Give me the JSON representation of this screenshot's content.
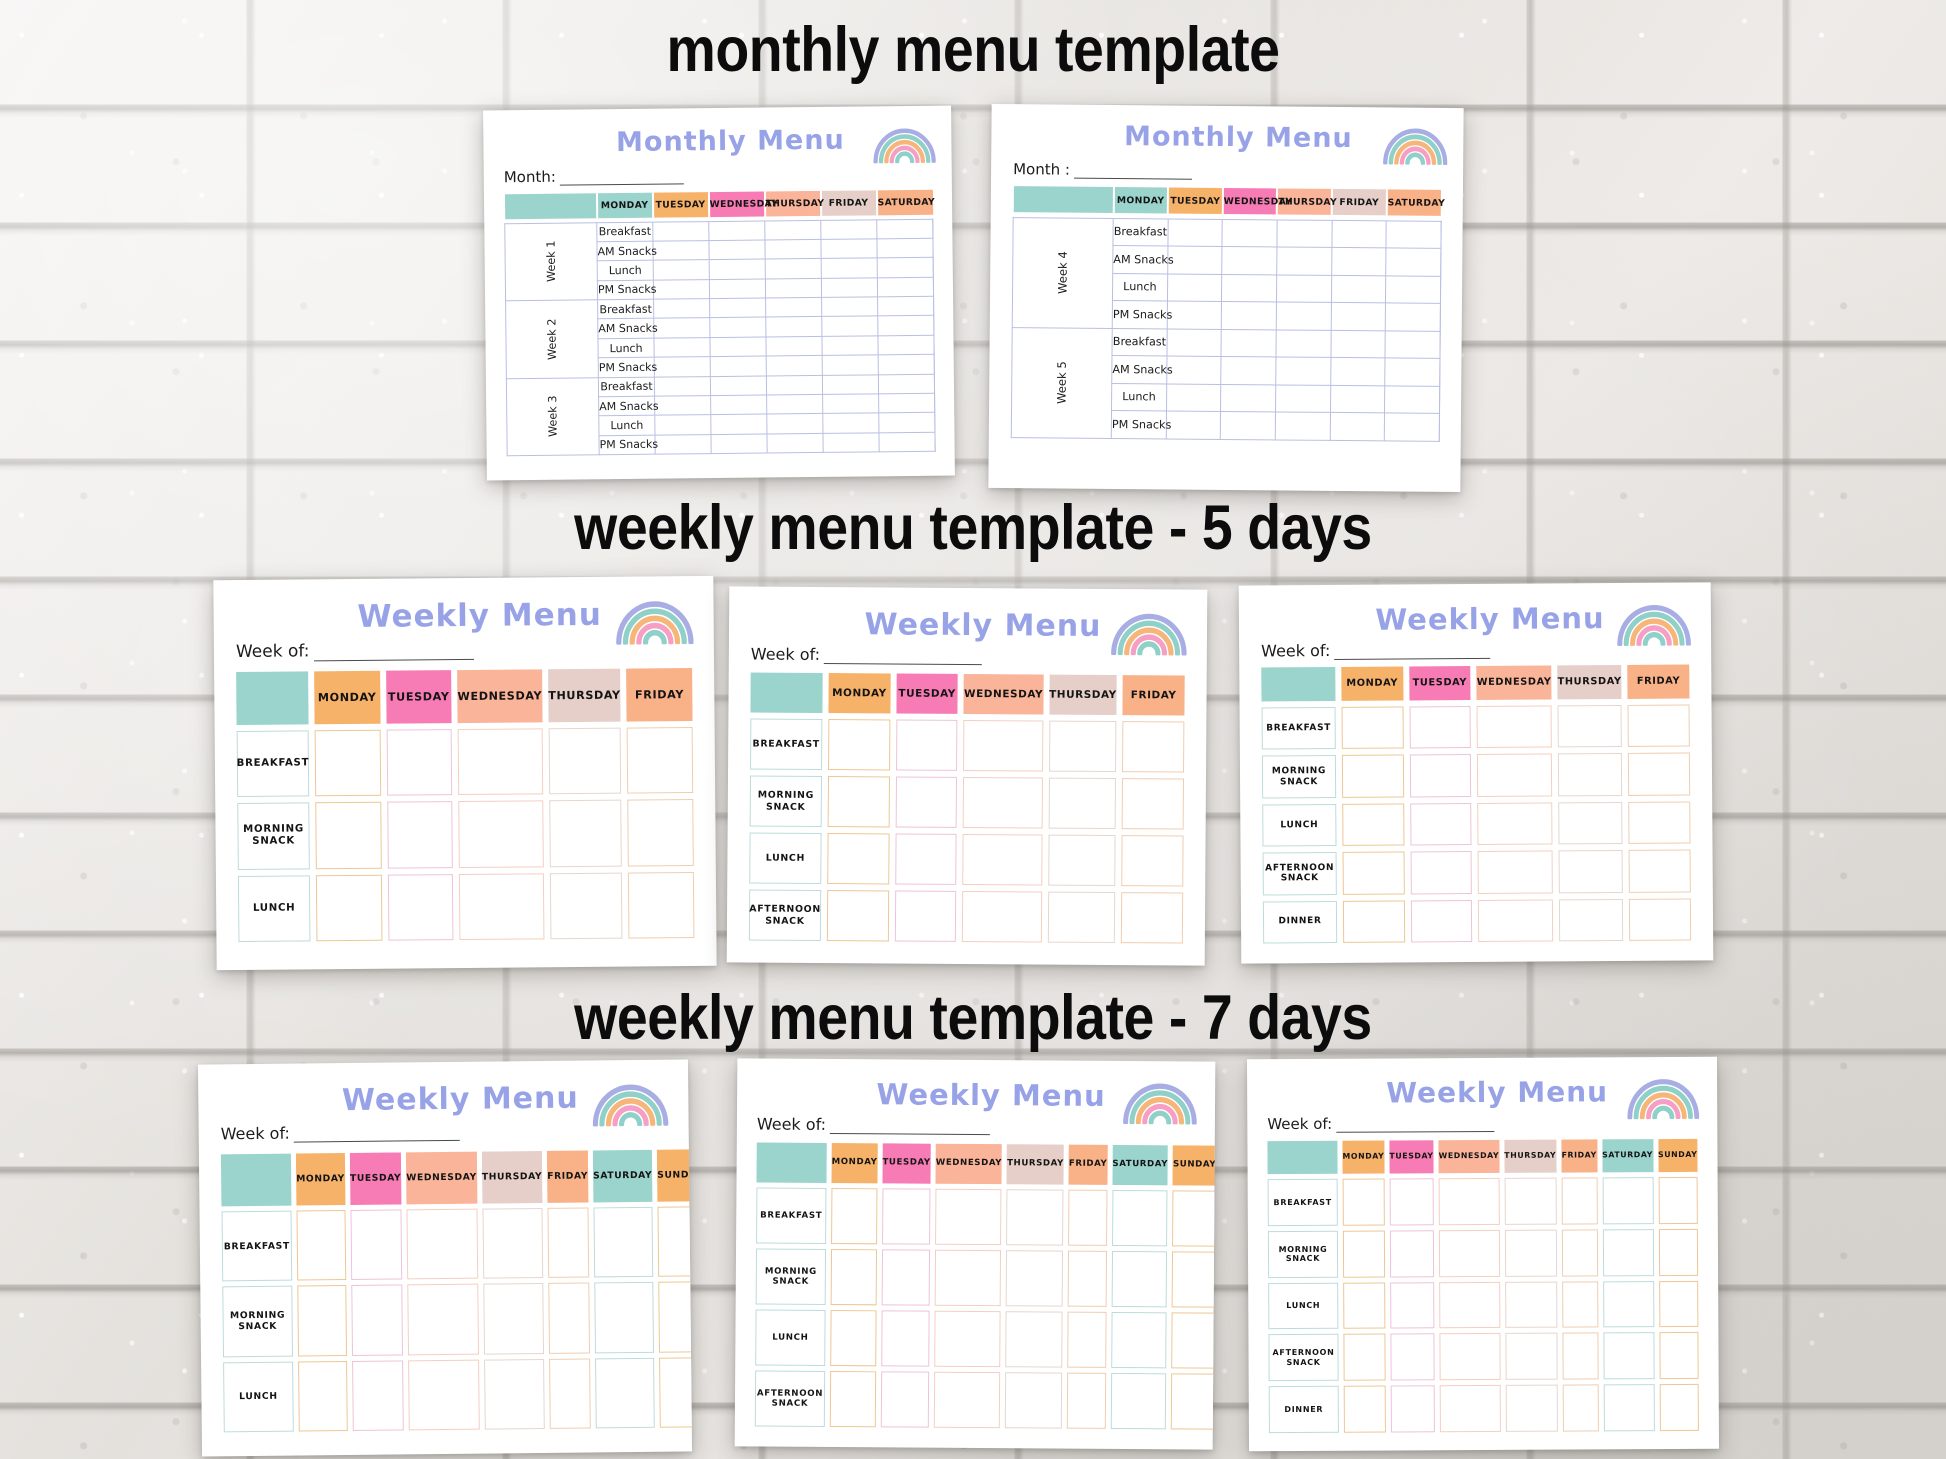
{
  "sections": [
    {
      "id": "monthly",
      "title": "monthly menu template"
    },
    {
      "id": "weekly5",
      "title": "weekly menu template - 5 days"
    },
    {
      "id": "weekly7",
      "title": "weekly menu template - 7 days"
    }
  ],
  "colors": {
    "title_purple": "#98a3e7",
    "teal": "#9ad4cd",
    "orange": "#f7b26a",
    "pink": "#f77bb4",
    "peach": "#fab49a",
    "blush": "#e5cfc8",
    "orange2": "#f9b187",
    "grid_line": "#b9bfe3",
    "heading_black": "#0c0c0c",
    "border_teal": "#bcdcdb",
    "border_orange": "#edc794",
    "border_pink": "#eec3d8",
    "border_peach": "#f4cfc0",
    "border_blush": "#e6d6cf",
    "border_orange2": "#f0cdb0"
  },
  "rainbow": {
    "name": "rainbow-icon",
    "arc_colors": [
      "#a8aee4",
      "#8fd0c8",
      "#f6b679",
      "#f79ec4",
      "#8fd0c8",
      "#f4a85f"
    ]
  },
  "monthly": {
    "card_title": "Monthly Menu",
    "days": [
      "MONDAY",
      "TUESDAY",
      "WEDNESDAY",
      "THURSDAY",
      "FRIDAY",
      "SATURDAY"
    ],
    "day_colors": [
      "#9ad4cd",
      "#f7b26a",
      "#f77bb4",
      "#fab49a",
      "#e5cfc8",
      "#f9b187"
    ],
    "corner_color": "#9ad4cd",
    "meals": [
      "Breakfast",
      "AM Snacks",
      "Lunch",
      "PM Snacks"
    ],
    "cards": [
      {
        "field_label": "Month:",
        "weeks": [
          "Week 1",
          "Week 2",
          "Week 3"
        ]
      },
      {
        "field_label": "Month :",
        "weeks": [
          "Week 4",
          "Week 5"
        ]
      }
    ]
  },
  "weekly5": {
    "card_title": "Weekly Menu",
    "field_label": "Week of:",
    "days": [
      "MONDAY",
      "TUESDAY",
      "WEDNESDAY",
      "THURSDAY",
      "FRIDAY"
    ],
    "day_colors": [
      "#f7b26a",
      "#f77bb4",
      "#fab49a",
      "#e5cfc8",
      "#f9b187"
    ],
    "cell_borders": [
      "#edc794",
      "#eec3d8",
      "#f4cfc0",
      "#e6d6cf",
      "#f0cdb0"
    ],
    "corner_color": "#9ad4cd",
    "rowlbl_border": "#bcdcdb",
    "cards": [
      {
        "rows": [
          "BREAKFAST",
          "MORNING SNACK",
          "LUNCH"
        ]
      },
      {
        "rows": [
          "BREAKFAST",
          "MORNING SNACK",
          "LUNCH",
          "AFTERNOON SNACK"
        ]
      },
      {
        "rows": [
          "BREAKFAST",
          "MORNING SNACK",
          "LUNCH",
          "AFTERNOON SNACK",
          "DINNER"
        ]
      }
    ]
  },
  "weekly7": {
    "card_title": "Weekly Menu",
    "field_label": "Week of:",
    "days": [
      "MONDAY",
      "TUESDAY",
      "WEDNESDAY",
      "THURSDAY",
      "FRIDAY",
      "SATURDAY",
      "SUNDAY"
    ],
    "day_colors": [
      "#f7b26a",
      "#f77bb4",
      "#fab49a",
      "#e5cfc8",
      "#f9b187",
      "#9ad4cd",
      "#f7b26a"
    ],
    "cell_borders": [
      "#edc794",
      "#eec3d8",
      "#f4cfc0",
      "#e6d6cf",
      "#f0cdb0",
      "#bcdcdb",
      "#edc794"
    ],
    "corner_color": "#9ad4cd",
    "rowlbl_border": "#bcdcdb",
    "cards": [
      {
        "rows": [
          "BREAKFAST",
          "MORNING SNACK",
          "LUNCH"
        ]
      },
      {
        "rows": [
          "BREAKFAST",
          "MORNING SNACK",
          "LUNCH",
          "AFTERNOON SNACK"
        ]
      },
      {
        "rows": [
          "BREAKFAST",
          "MORNING SNACK",
          "LUNCH",
          "AFTERNOON SNACK",
          "DINNER"
        ]
      }
    ]
  }
}
